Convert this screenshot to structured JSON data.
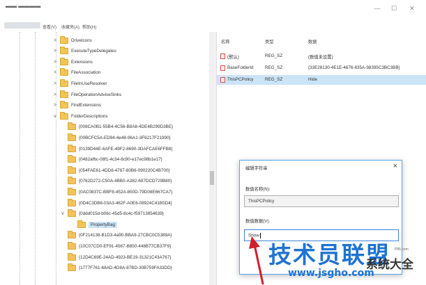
{
  "menu": [
    "查看(V)",
    "收藏夹(A)",
    "帮助(H)"
  ],
  "tree": [
    {
      "label": "DriveIcons",
      "expander": ">",
      "selected": false
    },
    {
      "label": "ExecuteTypeDelegates",
      "expander": ">",
      "selected": false
    },
    {
      "label": "Extensions",
      "expander": ">",
      "selected": false
    },
    {
      "label": "FileAssociation",
      "expander": ">",
      "selected": false
    },
    {
      "label": "FileInUseResolver",
      "expander": ">",
      "selected": false
    },
    {
      "label": "FileOperationAdviseSinks",
      "expander": ">",
      "selected": false
    },
    {
      "label": "FindExtensions",
      "expander": ">",
      "selected": false
    },
    {
      "label": "FolderDescriptions",
      "expander": "v",
      "selected": false
    },
    {
      "label": "{008CA0B1-55B4-4C56-B8A8-4DE4B299D3BE}",
      "expander": "",
      "selected": false
    },
    {
      "label": "{00BCFC5A-ED94-4e48-96A1-3F6217F21990}",
      "expander": "",
      "selected": false
    },
    {
      "label": "{0139D44E-6AFE-49F2-8690-3DAFCAE6FFB8}",
      "expander": "",
      "selected": false
    },
    {
      "label": "{0482af6c-08f1-4c34-8c90-e17ec98b1e17}",
      "expander": "",
      "selected": false
    },
    {
      "label": "{054FAE61-4DD8-4787-80B6-090220C4B700}",
      "expander": "",
      "selected": false
    },
    {
      "label": "{0762D272-C50A-4BB0-A382-697DCD729B80}",
      "expander": "",
      "selected": false
    },
    {
      "label": "{0AC0837C-BBF8-452A-850D-79D08E667CA7}",
      "expander": "",
      "selected": false
    },
    {
      "label": "{0D4C3DB6-03A3-462F-A0E6-08924C41B5D4}",
      "expander": "",
      "selected": false
    },
    {
      "label": "{0ddd015d-b06c-45d5-8c4c-f59713854639}",
      "expander": "v",
      "selected": false
    },
    {
      "label": "PropertyBag",
      "expander": "",
      "selected": true
    },
    {
      "label": "{0F214138-B1D3-4a90-BBA9-27CBC0C5389A}",
      "expander": "",
      "selected": false
    },
    {
      "label": "{10C07CD0-EF91-4567-B850-448B77CB37F9}",
      "expander": "",
      "selected": false
    },
    {
      "label": "{12D4C69E-24AD-4923-BE19-31321C43A767}",
      "expander": "",
      "selected": false
    },
    {
      "label": "{1777F761-68AD-4D8A-87BD-30B759FA33DD}",
      "expander": "",
      "selected": false
    }
  ],
  "columns": {
    "name": "名称",
    "type": "类型",
    "data": "数据"
  },
  "values": [
    {
      "name": "(默认)",
      "type": "REG_SZ",
      "data": "(数值未设置)",
      "selected": false
    },
    {
      "name": "BaseFolderId",
      "type": "REG_SZ",
      "data": "{33E28130-4E1E-4676-835A-98395C3BC3BB}",
      "selected": false
    },
    {
      "name": "ThisPCPolicy",
      "type": "REG_SZ",
      "data": "Hide",
      "selected": true
    }
  ],
  "dialog": {
    "title": "编辑字符串",
    "close": "×",
    "name_label": "数值名称(N):",
    "name_value": "ThisPCPolicy",
    "data_label": "数值数据(V):",
    "data_value": "Show"
  },
  "watermark": {
    "brand": "技术员联盟",
    "url": "www.jsgho.com",
    "site2": "系统大全",
    "domain": "P85.com"
  },
  "colors": {
    "selection": "#cce4f7",
    "folder": "#f2c45a",
    "dialog_border": "#5aa5e6",
    "arrow": "#d0202a",
    "watermark": "#1e73d2"
  }
}
